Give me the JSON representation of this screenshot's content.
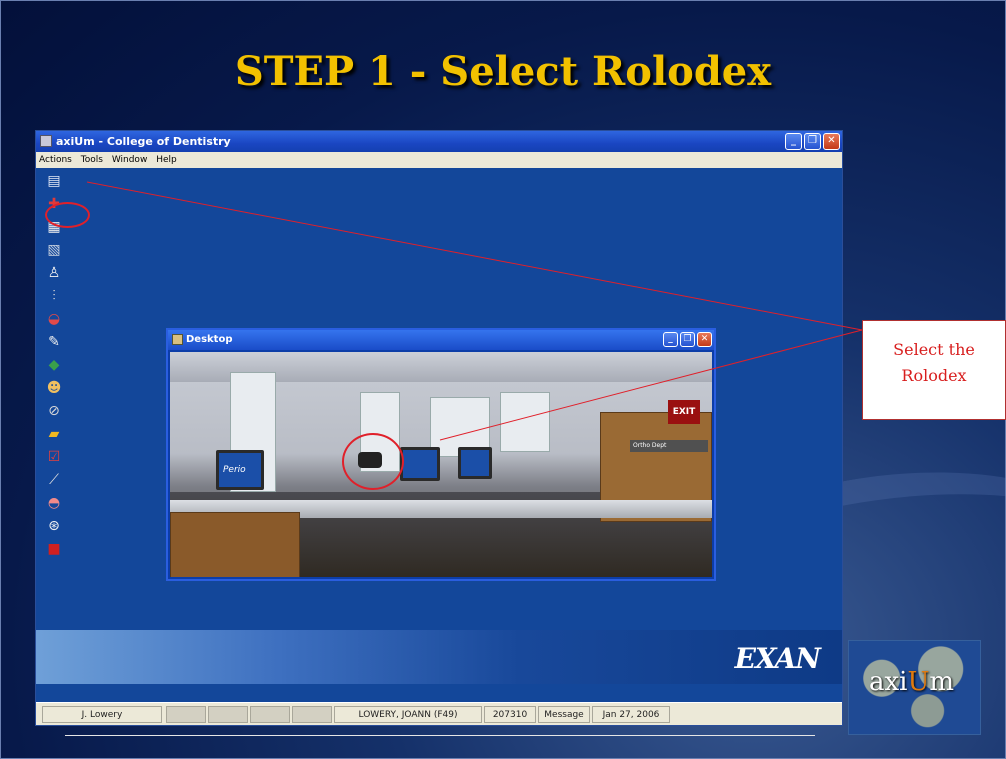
{
  "slide": {
    "title": "STEP 1 - Select Rolodex",
    "callout": "Select the Rolodex"
  },
  "app": {
    "title": "axiUm - College of Dentistry",
    "menu": [
      "Actions",
      "Tools",
      "Window",
      "Help"
    ],
    "window_buttons": [
      "minimize",
      "restore",
      "close"
    ],
    "toolbar_icons": [
      "rolodex-icon",
      "patient-chart-icon",
      "schedule-icon",
      "calculator-icon",
      "tooth-icon",
      "settings-sliders-icon",
      "dentures-icon",
      "pen-icon",
      "forms-icon",
      "people-icon",
      "compass-icon",
      "folder-icon",
      "checkbox-icon",
      "probe-icon",
      "gum-icon",
      "help-icon",
      "briefcase-icon"
    ]
  },
  "desktop_window": {
    "title": "Desktop",
    "exit_sign": "EXIT",
    "ortho_sign": "Ortho Dept",
    "monitor_label": "Perio"
  },
  "brand": {
    "band_logo": "EXAN",
    "corner_logo_a": "axi",
    "corner_logo_u": "U",
    "corner_logo_b": "m"
  },
  "status_bar": {
    "user": "J. Lowery",
    "patient": "LOWERY, JOANN (F49)",
    "chart_number": "207310",
    "message": "Message",
    "date": "Jan 27, 2006"
  },
  "colors": {
    "title": "#f2c100",
    "callout_text": "#d81e1e",
    "highlight": "#e0202a",
    "app_background": "#13479a"
  }
}
